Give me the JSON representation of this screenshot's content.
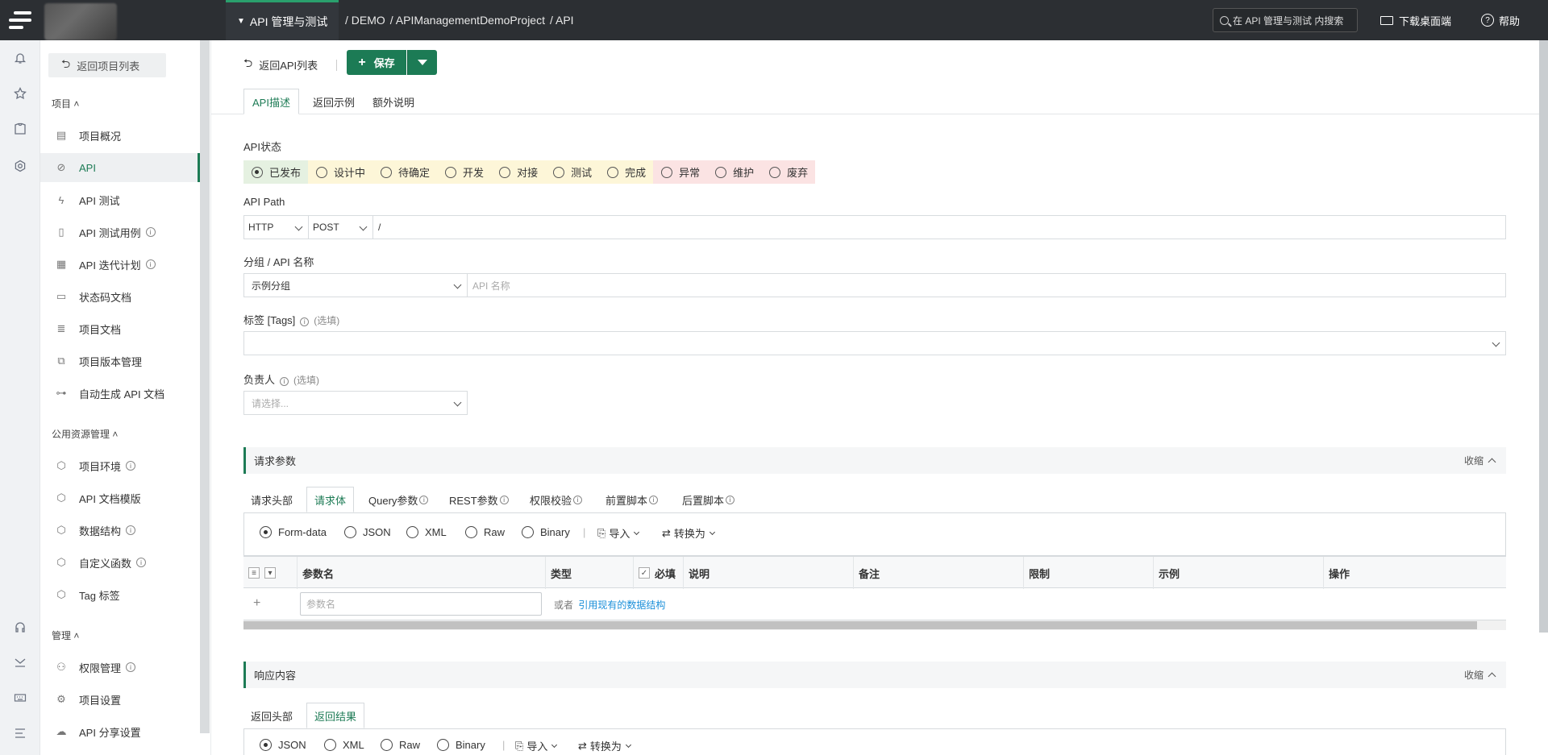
{
  "topbar": {
    "module": "API 管理与测试",
    "breadcrumb": [
      "/ DEMO",
      "/ APIManagementDemoProject",
      "/ API"
    ],
    "search_placeholder": "在 API 管理与测试 内搜索",
    "download": "下载桌面端",
    "help": "帮助"
  },
  "sidebar": {
    "back": "返回项目列表",
    "group_project": "项目",
    "group_public": "公用资源管理",
    "group_manage": "管理",
    "project_items": [
      {
        "label": "项目概况",
        "icon": "overview-icon"
      },
      {
        "label": "API",
        "icon": "tag-icon"
      },
      {
        "label": "API 测试",
        "icon": "flash-icon"
      },
      {
        "label": "API 测试用例",
        "icon": "clipboard-icon"
      },
      {
        "label": "API 迭代计划",
        "icon": "calendar-icon"
      },
      {
        "label": "状态码文档",
        "icon": "doc-icon"
      },
      {
        "label": "项目文档",
        "icon": "doc-list-icon"
      },
      {
        "label": "项目版本管理",
        "icon": "copy-icon"
      },
      {
        "label": "自动生成 API 文档",
        "icon": "robot-icon"
      }
    ],
    "public_items": [
      {
        "label": "项目环境"
      },
      {
        "label": "API 文档模版"
      },
      {
        "label": "数据结构"
      },
      {
        "label": "自定义函数"
      },
      {
        "label": "Tag 标签"
      }
    ],
    "manage_items": [
      {
        "label": "权限管理"
      },
      {
        "label": "项目设置"
      },
      {
        "label": "API 分享设置"
      }
    ]
  },
  "toolbar": {
    "back": "返回API列表",
    "save": "保存"
  },
  "tabs": [
    "API描述",
    "返回示例",
    "额外说明"
  ],
  "form": {
    "status_label": "API状态",
    "statuses": [
      "已发布",
      "设计中",
      "待确定",
      "开发",
      "对接",
      "测试",
      "完成",
      "异常",
      "维护",
      "废弃"
    ],
    "path_label": "API Path",
    "protocol": "HTTP",
    "method": "POST",
    "path": "/",
    "name_label": "分组 / API 名称",
    "group": "示例分组",
    "name_placeholder": "API 名称",
    "tags_label": "标签 [Tags]",
    "optional": "(选填)",
    "owner_label": "负责人",
    "owner_placeholder": "请选择..."
  },
  "request": {
    "title": "请求参数",
    "collapse": "收缩",
    "tabs": [
      "请求头部",
      "请求体",
      "Query参数",
      "REST参数",
      "权限校验",
      "前置脚本",
      "后置脚本"
    ],
    "formats": [
      "Form-data",
      "JSON",
      "XML",
      "Raw",
      "Binary"
    ],
    "import": "导入",
    "convert": "转换为",
    "columns": [
      "参数名",
      "类型",
      "必填",
      "说明",
      "备注",
      "限制",
      "示例",
      "操作"
    ],
    "param_placeholder": "参数名",
    "or": "或者",
    "ref_link": "引用现有的数据结构"
  },
  "response": {
    "title": "响应内容",
    "collapse": "收缩",
    "tabs": [
      "返回头部",
      "返回结果"
    ],
    "formats": [
      "JSON",
      "XML",
      "Raw",
      "Binary"
    ],
    "import": "导入",
    "convert": "转换为"
  },
  "colors": {
    "brand": "#1c7b55",
    "topbar": "#2c2f33",
    "status_green": "#e5f1e1",
    "status_yellow": "#fdf6d8",
    "status_red": "#fbe3e3"
  }
}
